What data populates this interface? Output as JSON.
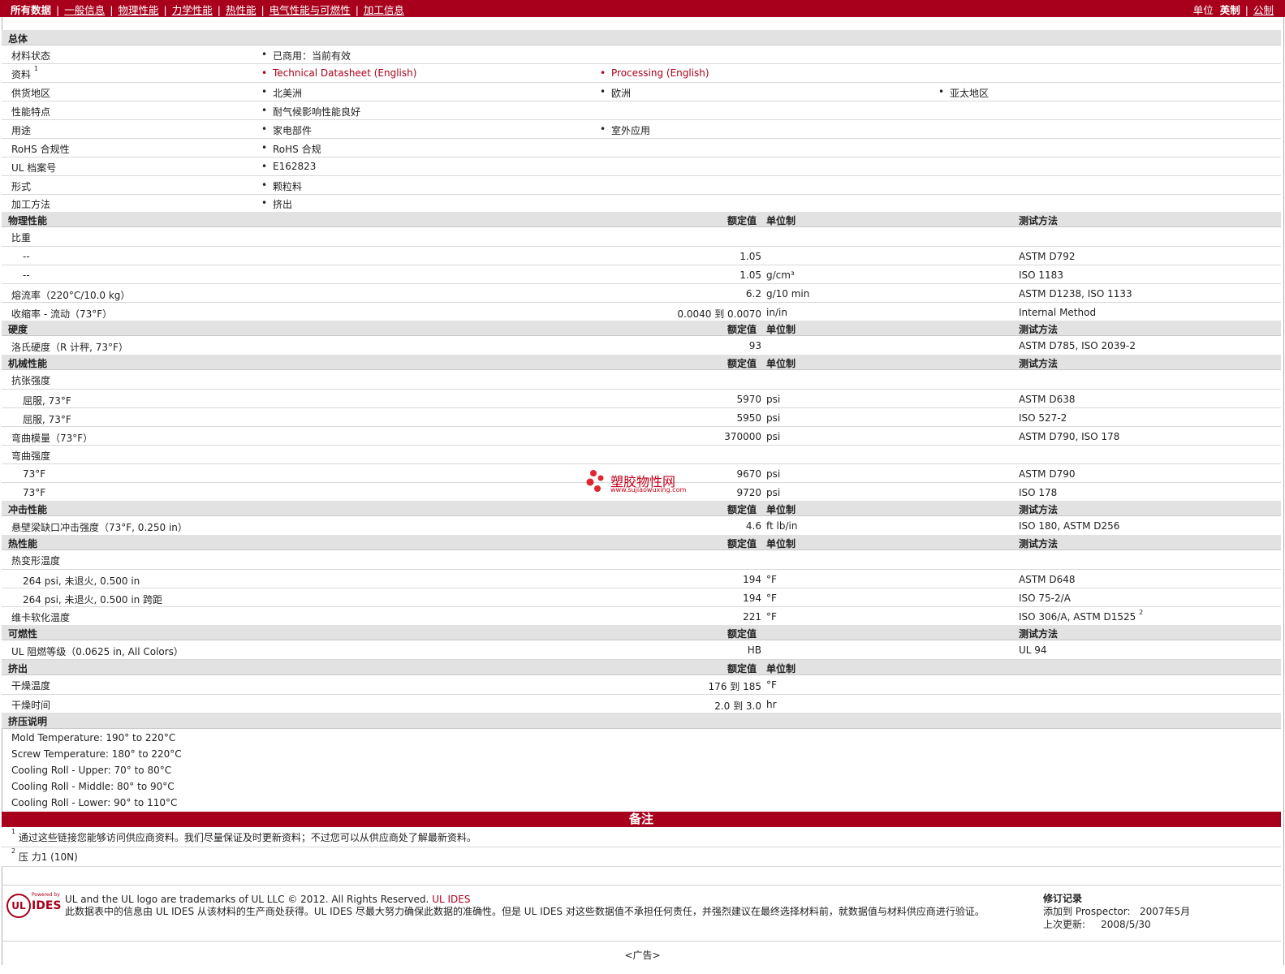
{
  "nav": {
    "items": [
      "所有数据",
      "一般信息",
      "物理性能",
      "力学性能",
      "热性能",
      "电气性能与可燃性",
      "加工信息"
    ],
    "units_label": "单位",
    "unit_english": "英制",
    "unit_metric": "公制"
  },
  "general": {
    "header": "总体",
    "rows": [
      {
        "label": "材料状态",
        "values": [
          "已商用：当前有效"
        ]
      },
      {
        "label": "资料",
        "sup": "1",
        "values": [
          "Technical Datasheet (English)",
          "Processing (English)"
        ]
      },
      {
        "label": "供货地区",
        "values": [
          "北美洲",
          "欧洲",
          "亚太地区"
        ]
      },
      {
        "label": "性能特点",
        "values": [
          "耐气候影响性能良好"
        ]
      },
      {
        "label": "用途",
        "values": [
          "家电部件",
          "室外应用"
        ]
      },
      {
        "label": "RoHS 合规性",
        "values": [
          "RoHS 合规"
        ]
      },
      {
        "label": "UL 档案号",
        "values": [
          "E162823"
        ]
      },
      {
        "label": "形式",
        "values": [
          "颗粒料"
        ]
      },
      {
        "label": "加工方法",
        "values": [
          "挤出"
        ]
      }
    ]
  },
  "headers": {
    "nominal": "额定值",
    "unit": "单位制",
    "method": "测试方法"
  },
  "sections": {
    "physical": {
      "title": "物理性能",
      "rows": [
        {
          "label": "比重",
          "value": "",
          "unit": "",
          "method": ""
        },
        {
          "label": "--",
          "value": "1.05",
          "unit": "",
          "method": "ASTM D792"
        },
        {
          "label": "--",
          "value": "1.05",
          "unit": "g/cm³",
          "method": "ISO 1183"
        },
        {
          "label": "熔流率（220°C/10.0 kg）",
          "value": "6.2",
          "unit": "g/10 min",
          "method": "ASTM D1238, ISO 1133"
        },
        {
          "label": "收缩率 - 流动（73°F）",
          "value": "0.0040 到  0.0070",
          "unit": "in/in",
          "method": "Internal Method"
        }
      ]
    },
    "hardness": {
      "title": "硬度",
      "rows": [
        {
          "label": "洛氏硬度（R 计秤, 73°F）",
          "value": "93",
          "unit": "",
          "method": "ASTM D785, ISO 2039-2"
        }
      ]
    },
    "mechanical": {
      "title": "机械性能",
      "rows": [
        {
          "label": "抗张强度",
          "value": "",
          "unit": "",
          "method": ""
        },
        {
          "label": "屈服, 73°F",
          "value": "5970",
          "unit": "psi",
          "method": "ASTM D638"
        },
        {
          "label": "屈服, 73°F",
          "value": "5950",
          "unit": "psi",
          "method": "ISO 527-2"
        },
        {
          "label": "弯曲模量（73°F）",
          "value": "370000",
          "unit": "psi",
          "method": "ASTM D790, ISO 178"
        },
        {
          "label": "弯曲强度",
          "value": "",
          "unit": "",
          "method": ""
        },
        {
          "label": "73°F",
          "value": "9670",
          "unit": "psi",
          "method": "ASTM D790"
        },
        {
          "label": "73°F",
          "value": "9720",
          "unit": "psi",
          "method": "ISO 178"
        }
      ]
    },
    "impact": {
      "title": "冲击性能",
      "rows": [
        {
          "label": "悬壁梁缺口冲击强度（73°F, 0.250 in）",
          "value": "4.6",
          "unit": "ft lb/in",
          "method": "ISO 180, ASTM D256"
        }
      ]
    },
    "thermal": {
      "title": "热性能",
      "rows": [
        {
          "label": "热变形温度",
          "value": "",
          "unit": "",
          "method": ""
        },
        {
          "label": "264 psi, 未退火, 0.500 in",
          "value": "194",
          "unit": "°F",
          "method": "ASTM D648"
        },
        {
          "label": "264 psi, 未退火, 0.500 in 跨距",
          "value": "194",
          "unit": "°F",
          "method": "ISO 75-2/A"
        },
        {
          "label": "维卡软化温度",
          "value": "221",
          "unit": "°F",
          "method": "ISO 306/A, ASTM D1525",
          "sup": "2"
        }
      ]
    },
    "flammability": {
      "title": "可燃性",
      "rows": [
        {
          "label": "UL 阻燃等级（0.0625 in, All Colors）",
          "value": "HB",
          "unit": "",
          "method": "UL 94"
        }
      ]
    },
    "extrusion": {
      "title": "挤出",
      "rows": [
        {
          "label": "干燥温度",
          "value": "176 到  185",
          "unit": "°F",
          "method": ""
        },
        {
          "label": "干燥时间",
          "value": "2.0 到  3.0",
          "unit": "hr",
          "method": ""
        }
      ]
    }
  },
  "extrusion_notes": {
    "title": "挤压说明",
    "lines": [
      "Mold Temperature: 190° to 220°C",
      "Screw Temperature: 180° to 220°C",
      "Cooling Roll - Upper: 70° to 80°C",
      "Cooling Roll - Middle: 80° to 90°C",
      "Cooling Roll - Lower: 90° to 110°C"
    ]
  },
  "notes": {
    "title": "备注",
    "footnotes": [
      {
        "num": "1",
        "text": "通过这些链接您能够访问供应商资料。我们尽量保证及时更新资料；不过您可以从供应商处了解最新资料。"
      },
      {
        "num": "2",
        "text": "压  力1 (10N)"
      }
    ]
  },
  "watermark": {
    "name": "塑胶物性网",
    "url": "www.sujiaowuxing.com"
  },
  "footer": {
    "logo_ul": "UL",
    "logo_powered": "Powered by",
    "logo_ides": "IDES",
    "trademark": "UL and the UL logo are trademarks of UL LLC © 2012. All Rights Reserved.",
    "trademark_link": "UL IDES",
    "disclaimer": "此数据表中的信息由  UL IDES 从该材料的生产商处获得。UL IDES 尽最大努力确保此数据的准确性。但是  UL IDES 对这些数据值不承担任何责任，并强烈建议在最终选择材料前，就数据值与材料供应商进行验证。",
    "rev_title": "修订记录",
    "added_label": "添加到  Prospector:",
    "added_value": "2007年5月",
    "updated_label": "上次更新:",
    "updated_value": "2008/5/30",
    "ad": "<广告>"
  }
}
